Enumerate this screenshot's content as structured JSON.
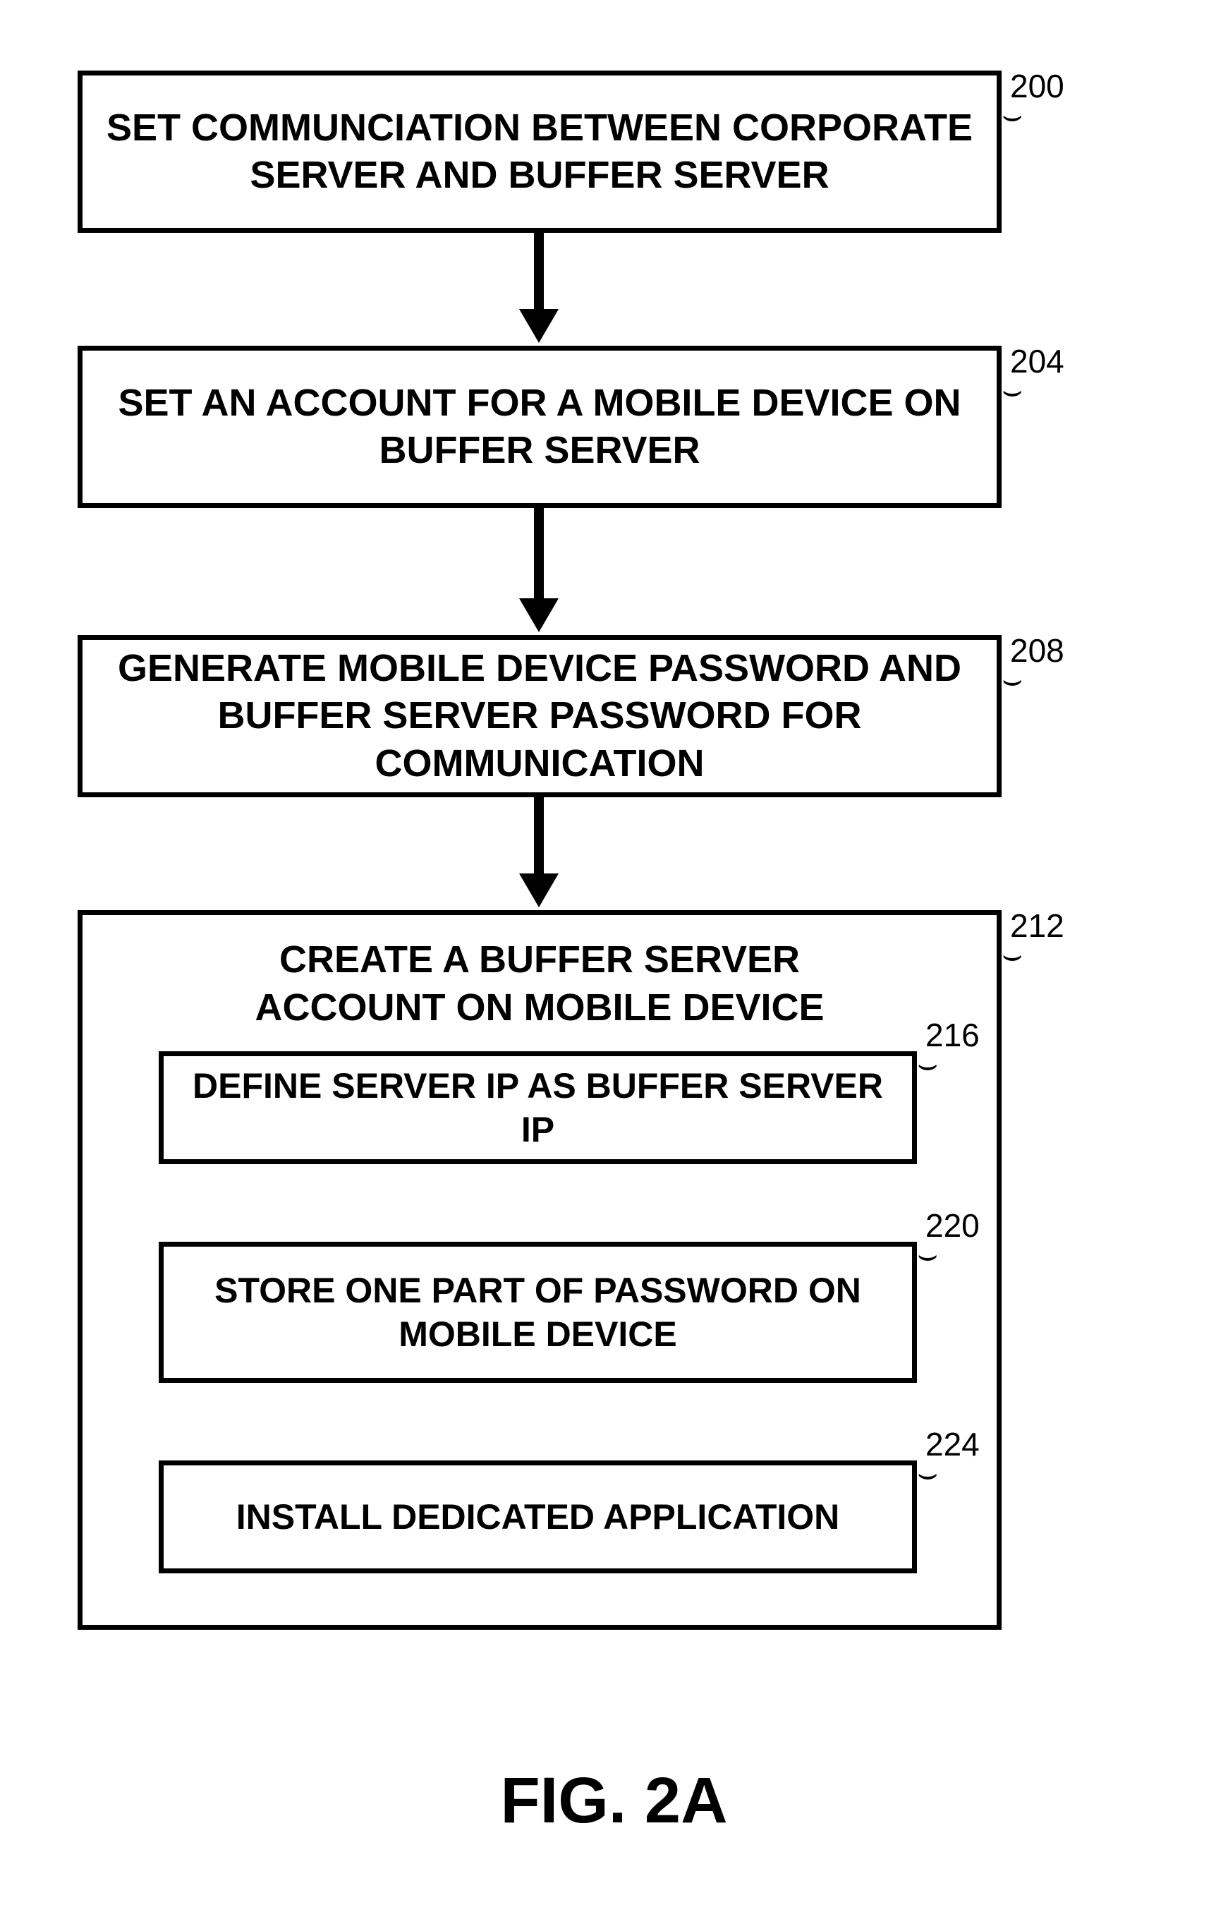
{
  "boxes": {
    "b200": "SET COMMUNCIATION BETWEEN CORPORATE SERVER AND BUFFER SERVER",
    "b204": "SET AN ACCOUNT FOR A MOBILE DEVICE ON BUFFER SERVER",
    "b208": "GENERATE MOBILE DEVICE PASSWORD AND BUFFER SERVER PASSWORD FOR COMMUNICATION",
    "b212_title": "CREATE A BUFFER SERVER ACCOUNT ON MOBILE DEVICE",
    "b216": "DEFINE SERVER IP AS BUFFER SERVER IP",
    "b220": "STORE ONE PART OF PASSWORD ON MOBILE DEVICE",
    "b224": "INSTALL DEDICATED APPLICATION"
  },
  "labels": {
    "l200": "200",
    "l204": "204",
    "l208": "208",
    "l212": "212",
    "l216": "216",
    "l220": "220",
    "l224": "224"
  },
  "caption": "FIG. 2A"
}
